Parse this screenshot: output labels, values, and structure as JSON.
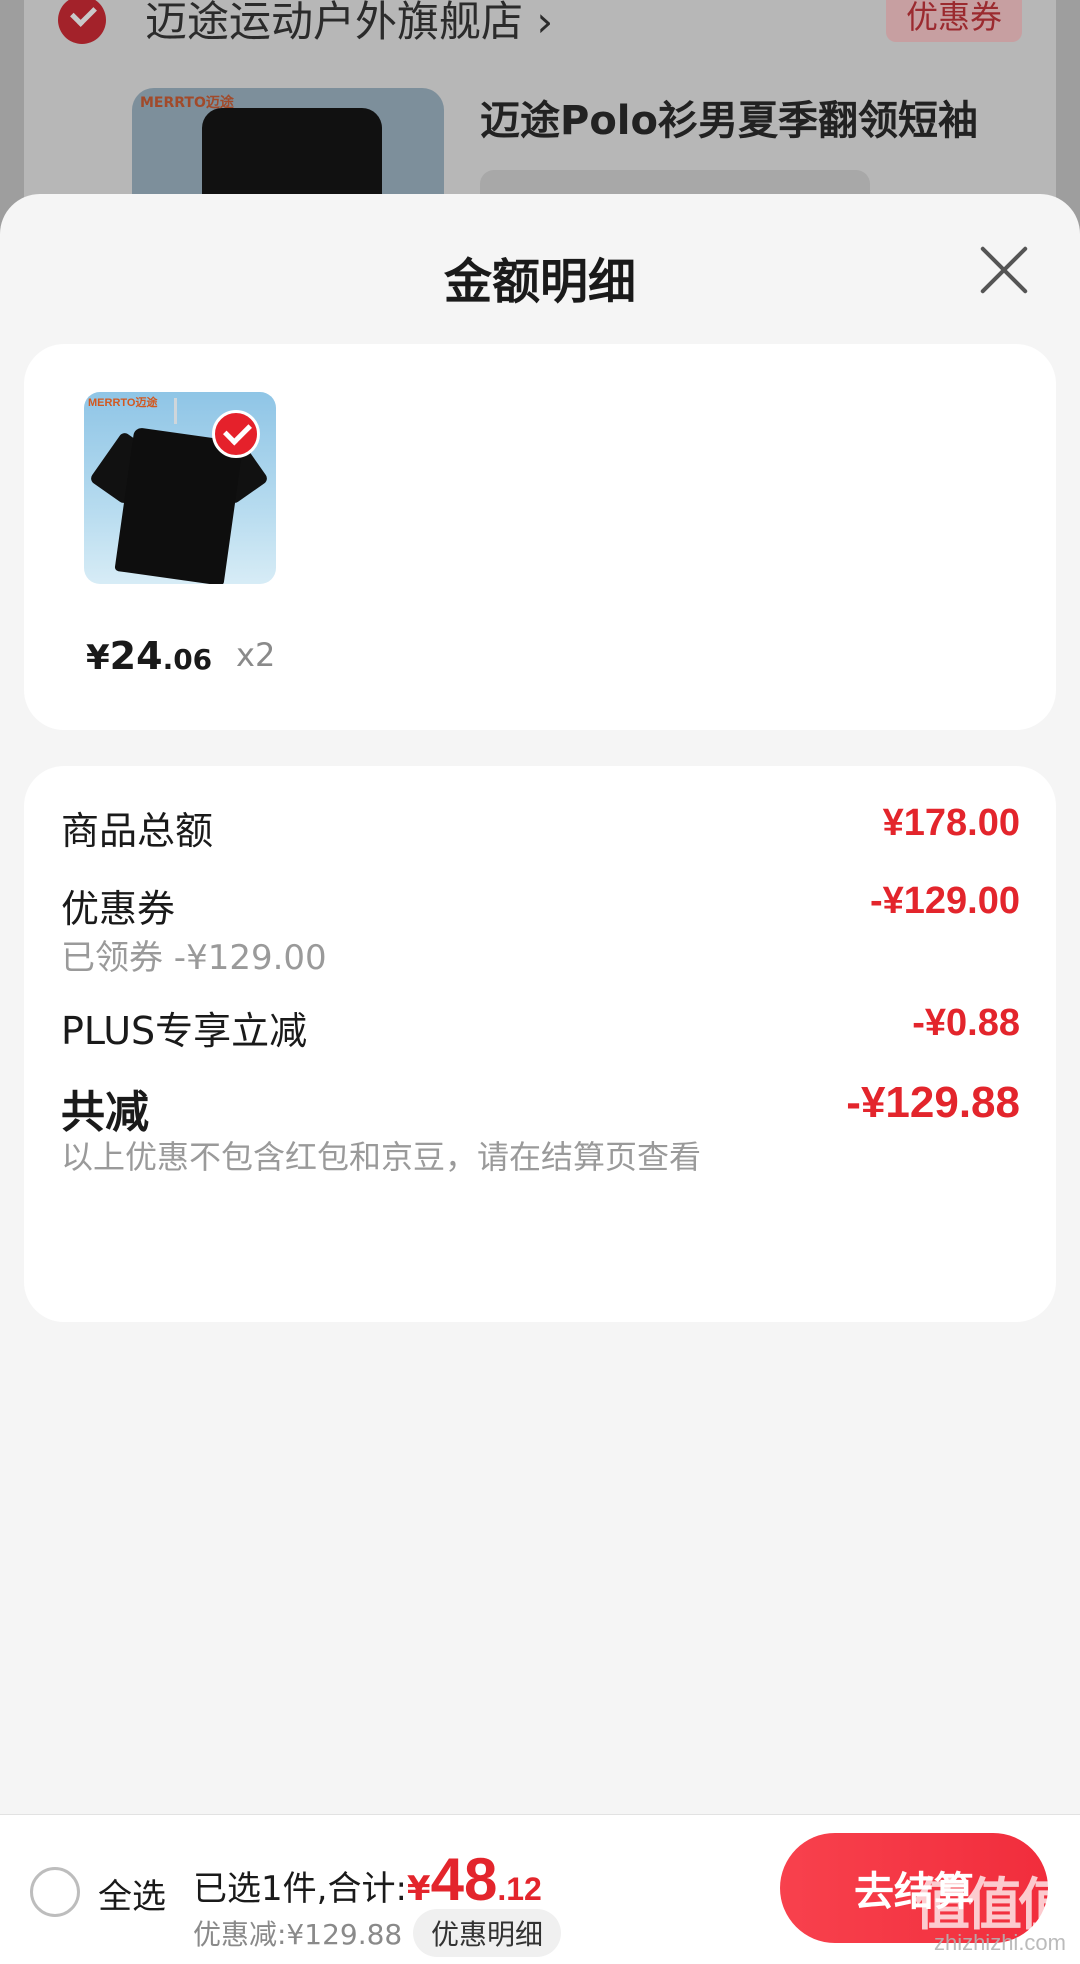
{
  "background": {
    "store_name": "迈途运动户外旗舰店 ›",
    "coupon_tag": "优惠券",
    "product_title": "迈途Polo衫男夏季翻领短袖",
    "thumb_brand": "MERRTO迈途"
  },
  "sheet": {
    "title": "金额明细",
    "close_icon": "close-icon"
  },
  "product": {
    "image_brand": "MERRTO迈途",
    "selected": true,
    "price_yen": "¥",
    "price_int": "24",
    "price_dec": ".06",
    "quantity": "x2"
  },
  "details": {
    "total_label": "商品总额",
    "total_value": "¥178.00",
    "coupon_label": "优惠券",
    "coupon_sub": "已领券 -¥129.00",
    "coupon_value": "-¥129.00",
    "plus_label": "PLUS专享立减",
    "plus_value": "-¥0.88",
    "reduce_label": "共减",
    "reduce_value": "-¥129.88",
    "note": "以上优惠不包含红包和京豆，请在结算页查看"
  },
  "bottom": {
    "select_all": "全选",
    "selected_text": "已选1件,合计:",
    "total_yen": "¥",
    "total_int": "48",
    "total_dec": ".12",
    "discount_text": "优惠减:¥129.88",
    "detail_button": "优惠明细",
    "checkout_button": "去结算"
  },
  "watermark": {
    "text": "值值值",
    "sub": "zhizhizhi.com"
  },
  "colors": {
    "accent_red": "#e3252c",
    "checkout_gradient_start": "#f8414d"
  }
}
